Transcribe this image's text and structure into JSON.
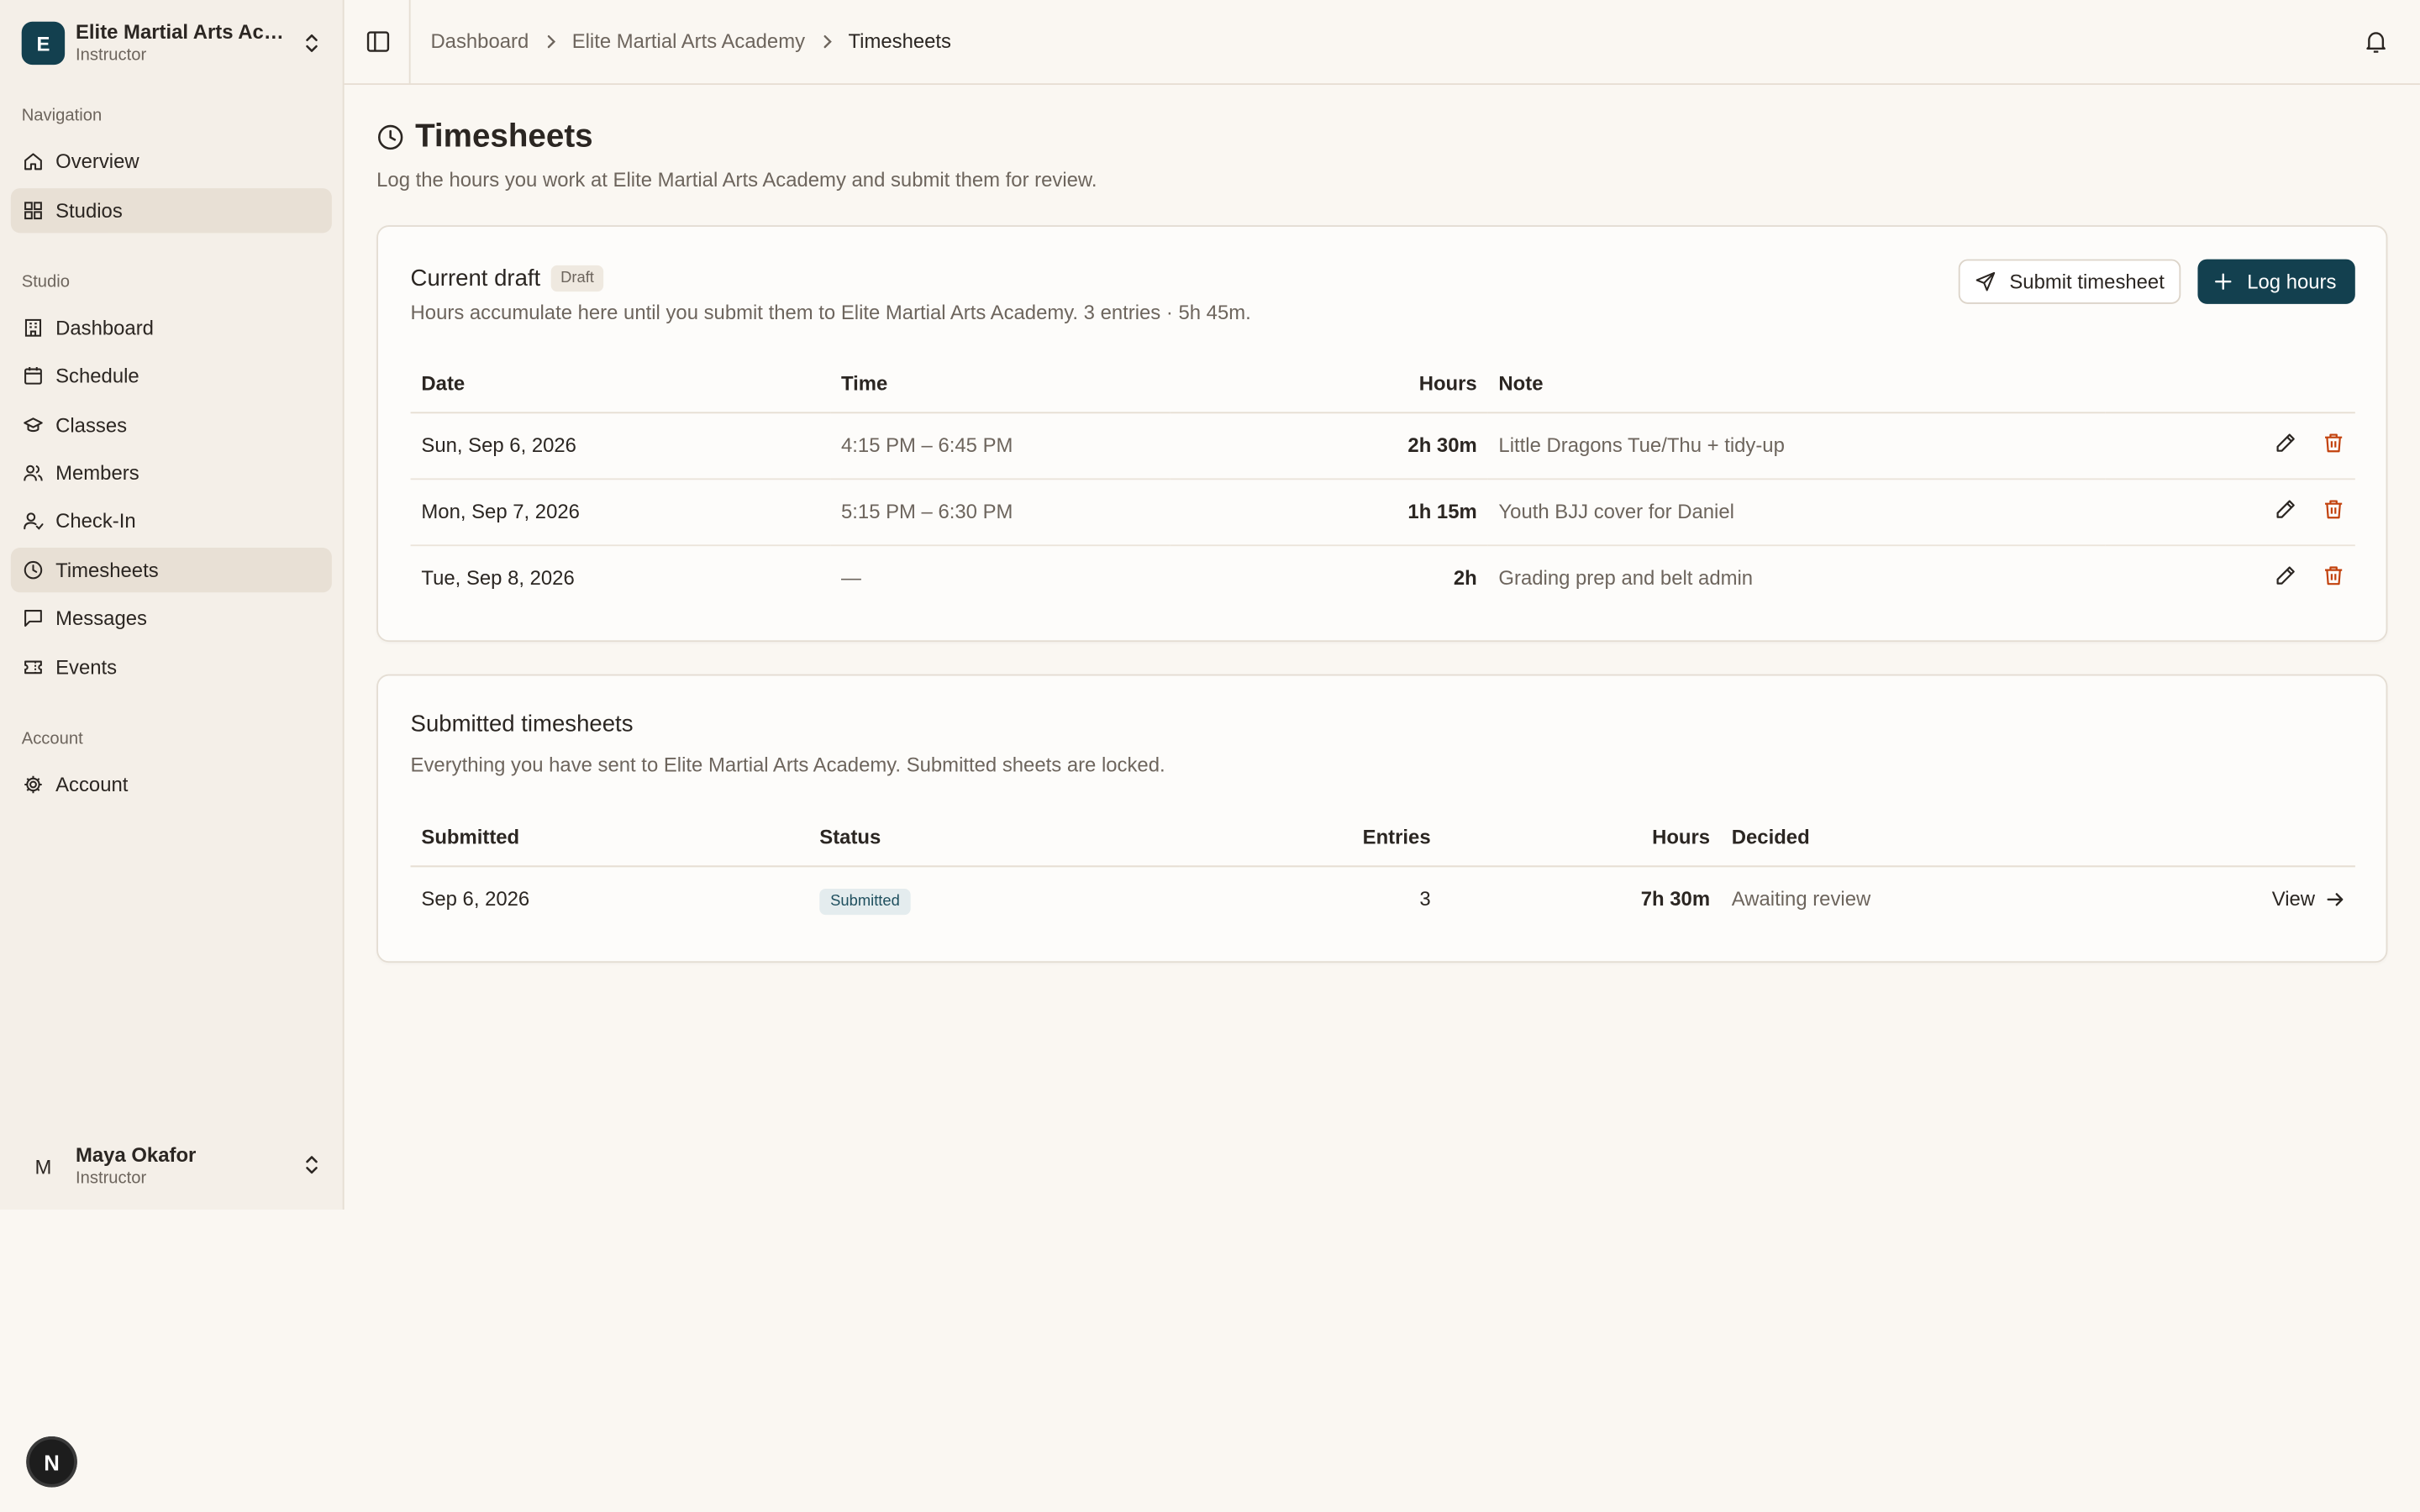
{
  "org": {
    "initial": "E",
    "name": "Elite Martial Arts Academy",
    "role": "Instructor"
  },
  "nav": {
    "section_navigation": "Navigation",
    "overview": "Overview",
    "studios": "Studios",
    "section_studio": "Studio",
    "dashboard": "Dashboard",
    "schedule": "Schedule",
    "classes": "Classes",
    "members": "Members",
    "checkin": "Check-In",
    "timesheets": "Timesheets",
    "messages": "Messages",
    "events": "Events",
    "section_account": "Account",
    "account": "Account"
  },
  "user": {
    "initial": "M",
    "name": "Maya Okafor",
    "role": "Instructor"
  },
  "breadcrumb": {
    "item1": "Dashboard",
    "item2": "Elite Martial Arts Academy",
    "item3": "Timesheets"
  },
  "page": {
    "title": "Timesheets",
    "subtitle": "Log the hours you work at Elite Martial Arts Academy and submit them for review."
  },
  "draft": {
    "title": "Current draft",
    "badge": "Draft",
    "description": "Hours accumulate here until you submit them to Elite Martial Arts Academy. 3 entries · 5h 45m.",
    "submit_label": "Submit timesheet",
    "log_label": "Log hours",
    "columns": {
      "date": "Date",
      "time": "Time",
      "hours": "Hours",
      "note": "Note"
    },
    "rows": [
      {
        "date": "Sun, Sep 6, 2026",
        "time": "4:15 PM – 6:45 PM",
        "hours": "2h 30m",
        "note": "Little Dragons Tue/Thu + tidy-up"
      },
      {
        "date": "Mon, Sep 7, 2026",
        "time": "5:15 PM – 6:30 PM",
        "hours": "1h 15m",
        "note": "Youth BJJ cover for Daniel"
      },
      {
        "date": "Tue, Sep 8, 2026",
        "time": "—",
        "hours": "2h",
        "note": "Grading prep and belt admin"
      }
    ]
  },
  "submitted": {
    "title": "Submitted timesheets",
    "description": "Everything you have sent to Elite Martial Arts Academy. Submitted sheets are locked.",
    "columns": {
      "submitted": "Submitted",
      "status": "Status",
      "entries": "Entries",
      "hours": "Hours",
      "decided": "Decided"
    },
    "rows": [
      {
        "submitted": "Sep 6, 2026",
        "status": "Submitted",
        "entries": "3",
        "hours": "7h 30m",
        "decided": "Awaiting review",
        "action": "View"
      }
    ]
  },
  "dev_badge": "N",
  "colors": {
    "brand": "#13404f",
    "background": "#faf7f2",
    "sidebar": "#f4efe8",
    "danger": "#c2410c"
  }
}
